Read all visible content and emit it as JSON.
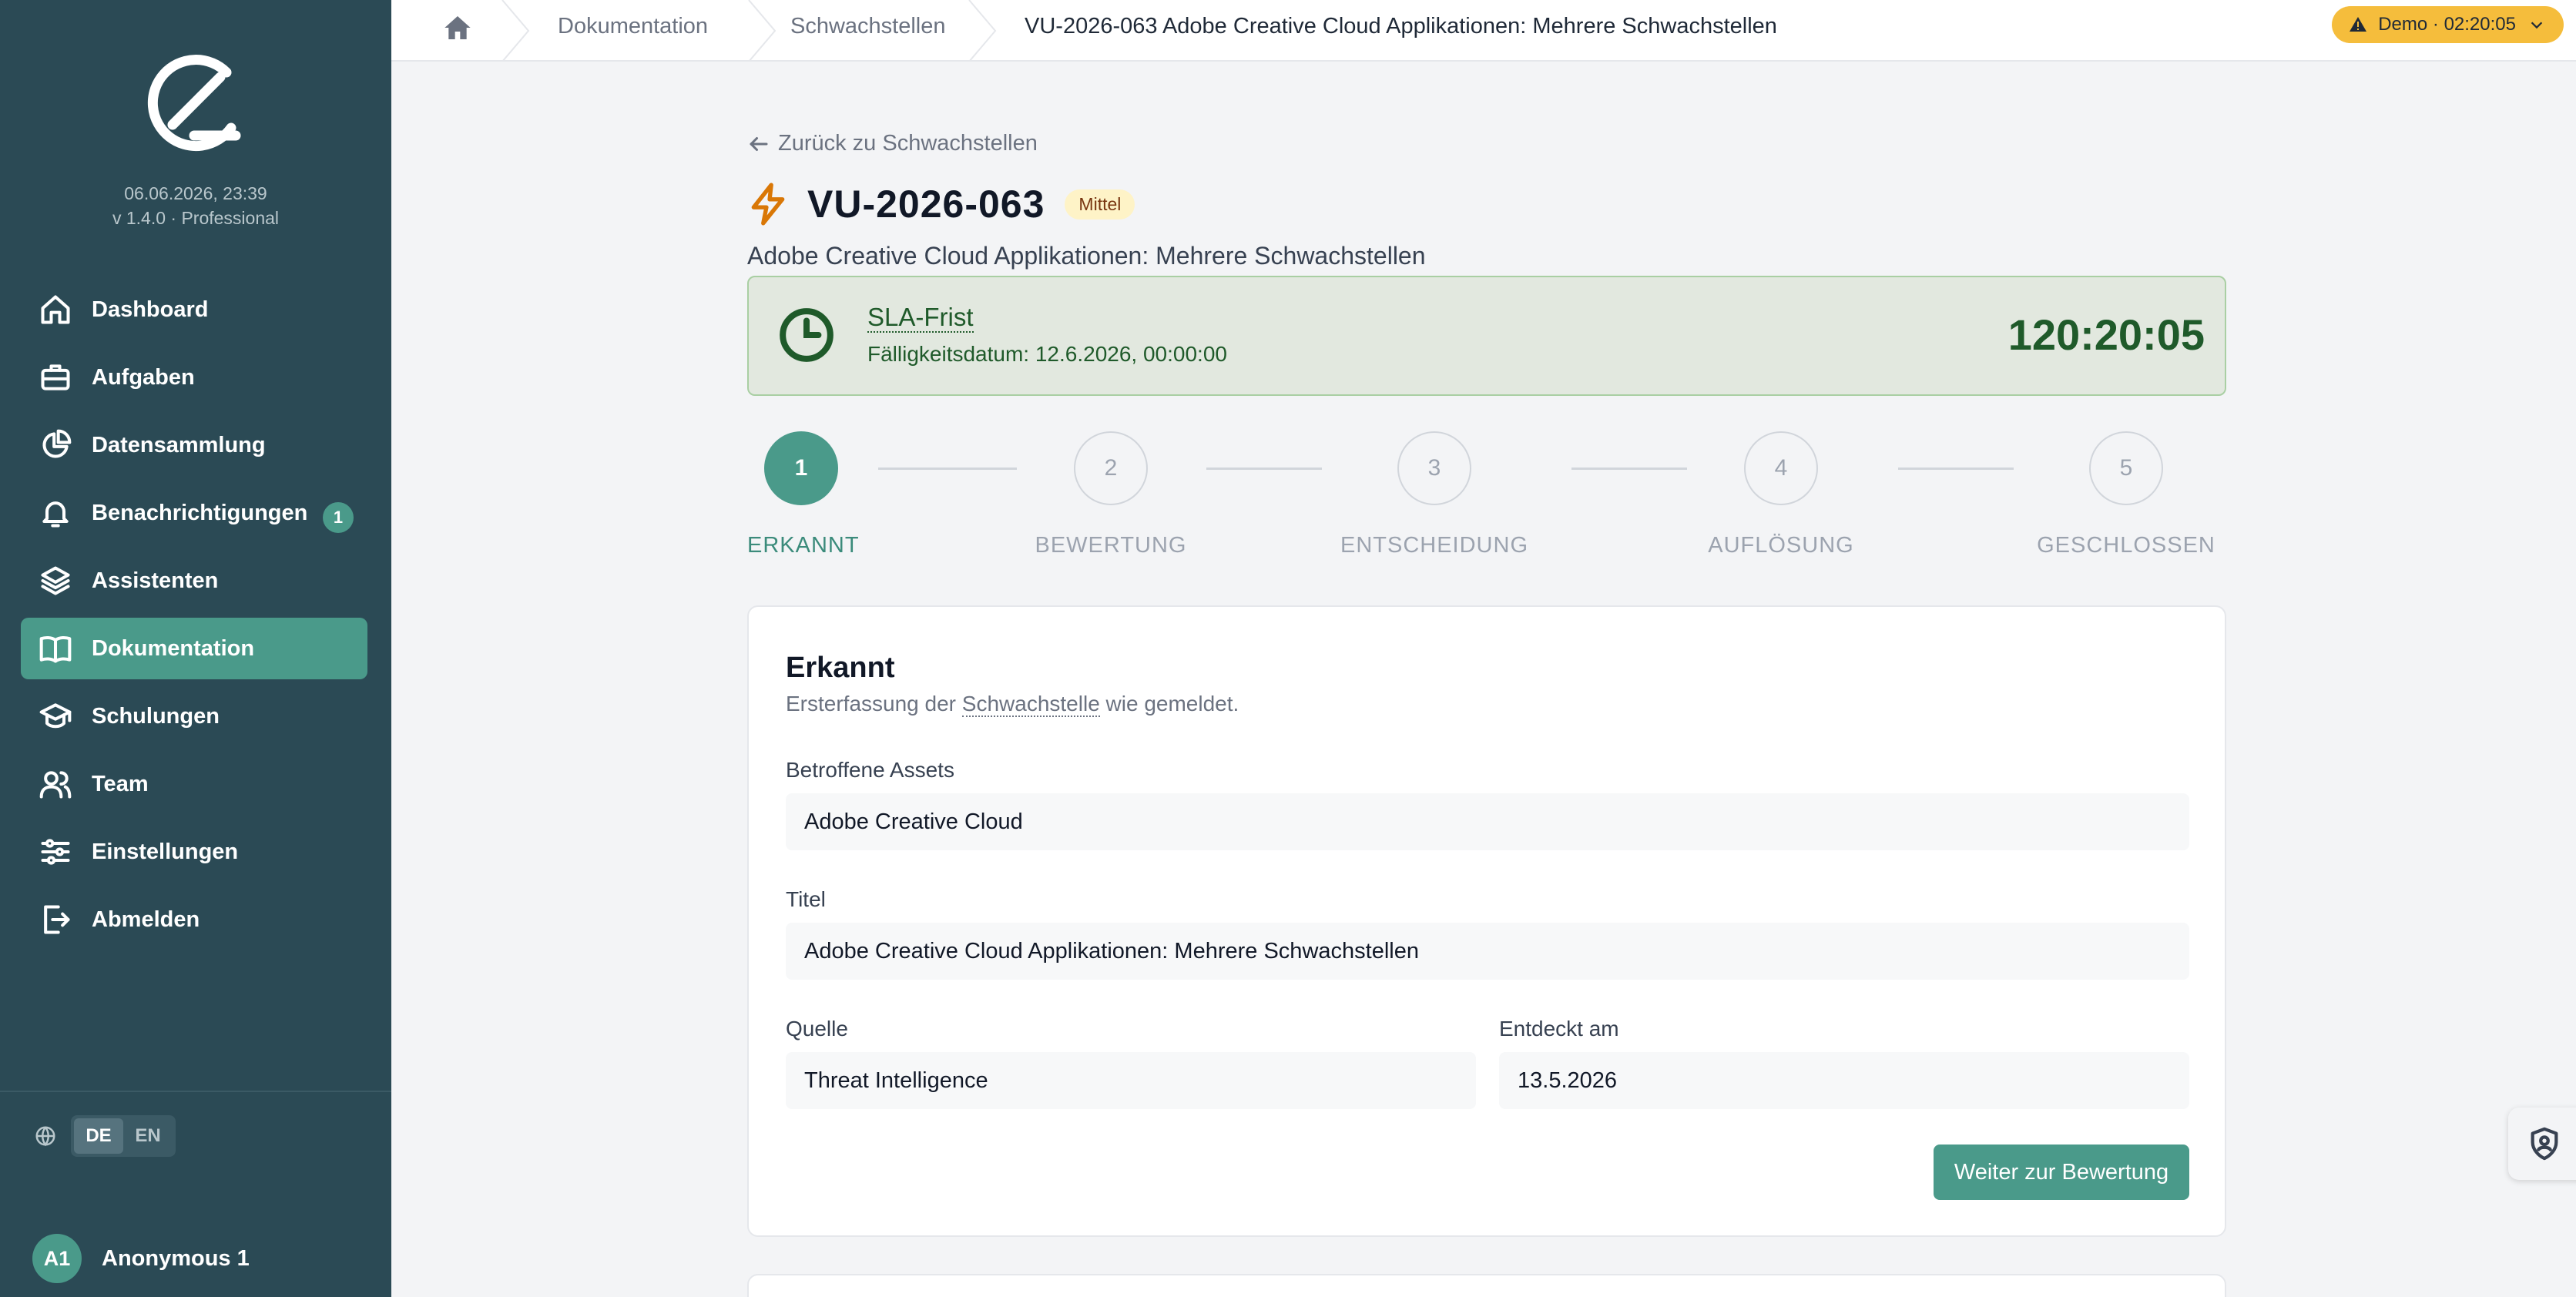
{
  "sidebar": {
    "logo_icon": "brand-logo-icon",
    "datetime": "06.06.2026, 23:39",
    "version": "v 1.4.0 · Professional",
    "nav": [
      {
        "label": "Dashboard",
        "icon": "home-icon"
      },
      {
        "label": "Aufgaben",
        "icon": "briefcase-icon"
      },
      {
        "label": "Datensammlung",
        "icon": "pie-chart-icon"
      },
      {
        "label": "Benachrichtigungen",
        "icon": "bell-icon",
        "badge": "1"
      },
      {
        "label": "Assistenten",
        "icon": "layers-icon"
      },
      {
        "label": "Dokumentation",
        "icon": "book-icon",
        "active": true
      },
      {
        "label": "Schulungen",
        "icon": "graduation-cap-icon"
      },
      {
        "label": "Team",
        "icon": "users-icon"
      },
      {
        "label": "Einstellungen",
        "icon": "sliders-icon"
      },
      {
        "label": "Abmelden",
        "icon": "logout-icon"
      }
    ],
    "language": {
      "options": [
        "DE",
        "EN"
      ],
      "selected": "DE"
    },
    "user": {
      "initials": "A1",
      "name": "Anonymous 1"
    }
  },
  "topbar": {
    "breadcrumbs": [
      "Dokumentation",
      "Schwachstellen",
      "VU-2026-063 Adobe Creative Cloud Applikationen: Mehrere Schwachstellen"
    ],
    "demo_label": "Demo · 02:20:05"
  },
  "main": {
    "back_link": "Zurück zu Schwachstellen",
    "vu_id": "VU-2026-063",
    "severity": "Mittel",
    "subtitle": "Adobe Creative Cloud Applikationen: Mehrere Schwachstellen",
    "sla": {
      "title": "SLA-Frist",
      "due_date": "Fälligkeitsdatum: 12.6.2026, 00:00:00",
      "timer": "120:20:05"
    },
    "steps": [
      {
        "number": "1",
        "label": "ERKANNT",
        "active": true
      },
      {
        "number": "2",
        "label": "BEWERTUNG"
      },
      {
        "number": "3",
        "label": "ENTSCHEIDUNG"
      },
      {
        "number": "4",
        "label": "AUFLÖSUNG"
      },
      {
        "number": "5",
        "label": "GESCHLOSSEN"
      }
    ],
    "card": {
      "title": "Erkannt",
      "desc_prefix": "Ersterfassung der ",
      "desc_link": "Schwachstelle",
      "desc_suffix": " wie gemeldet.",
      "assets_label": "Betroffene Assets",
      "assets_value": "Adobe Creative Cloud",
      "title_label": "Titel",
      "title_value": "Adobe Creative Cloud Applikationen: Mehrere Schwachstellen",
      "source_label": "Quelle",
      "source_value": "Threat Intelligence",
      "discovered_label": "Entdeckt am",
      "discovered_value": "13.5.2026",
      "next_button": "Weiter zur Bewertung"
    }
  },
  "colors": {
    "sidebar_bg": "#2b4a55",
    "accent": "#4a9a8a",
    "sla_text": "#1f5a2a",
    "demo_pill": "#f5bd3c",
    "severity_bg": "#fef3c7"
  }
}
